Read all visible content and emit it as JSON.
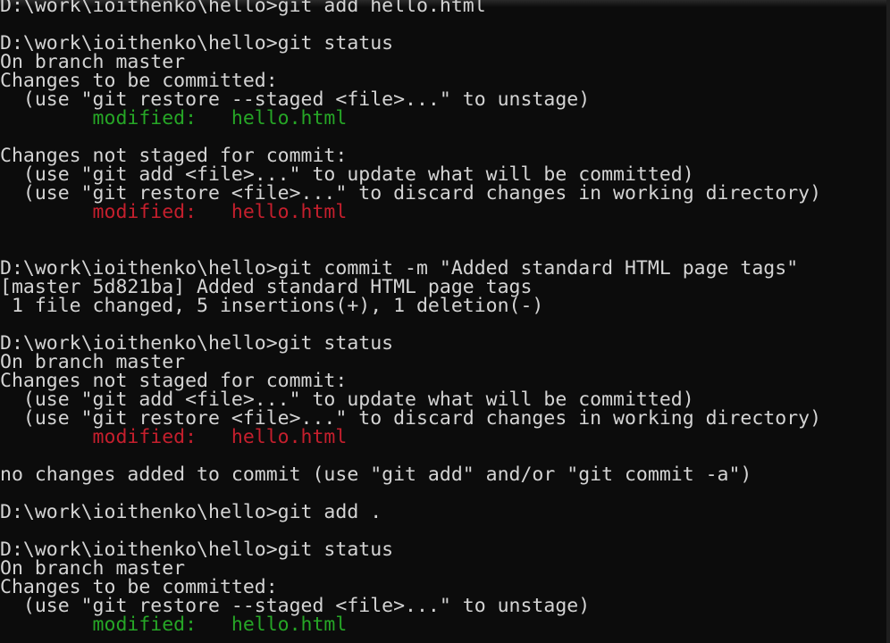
{
  "colors": {
    "background": "#0c0c0c",
    "text": "#d4d4d4",
    "staged": "#26a626",
    "unstaged": "#c51f2d"
  },
  "lines": [
    {
      "text": "D:\\work\\ioithenko\\hello>git add hello.html"
    },
    {
      "text": ""
    },
    {
      "text": "D:\\work\\ioithenko\\hello>git status"
    },
    {
      "text": "On branch master"
    },
    {
      "text": "Changes to be committed:"
    },
    {
      "text": "  (use \"git restore --staged <file>...\" to unstage)"
    },
    {
      "text": "        modified:   hello.html",
      "color": "green"
    },
    {
      "text": ""
    },
    {
      "text": "Changes not staged for commit:"
    },
    {
      "text": "  (use \"git add <file>...\" to update what will be committed)"
    },
    {
      "text": "  (use \"git restore <file>...\" to discard changes in working directory)"
    },
    {
      "text": "        modified:   hello.html",
      "color": "red"
    },
    {
      "text": ""
    },
    {
      "text": ""
    },
    {
      "text": "D:\\work\\ioithenko\\hello>git commit -m \"Added standard HTML page tags\""
    },
    {
      "text": "[master 5d821ba] Added standard HTML page tags"
    },
    {
      "text": " 1 file changed, 5 insertions(+), 1 deletion(-)"
    },
    {
      "text": ""
    },
    {
      "text": "D:\\work\\ioithenko\\hello>git status"
    },
    {
      "text": "On branch master"
    },
    {
      "text": "Changes not staged for commit:"
    },
    {
      "text": "  (use \"git add <file>...\" to update what will be committed)"
    },
    {
      "text": "  (use \"git restore <file>...\" to discard changes in working directory)"
    },
    {
      "text": "        modified:   hello.html",
      "color": "red"
    },
    {
      "text": ""
    },
    {
      "text": "no changes added to commit (use \"git add\" and/or \"git commit -a\")"
    },
    {
      "text": ""
    },
    {
      "text": "D:\\work\\ioithenko\\hello>git add ."
    },
    {
      "text": ""
    },
    {
      "text": "D:\\work\\ioithenko\\hello>git status"
    },
    {
      "text": "On branch master"
    },
    {
      "text": "Changes to be committed:"
    },
    {
      "text": "  (use \"git restore --staged <file>...\" to unstage)"
    },
    {
      "text": "        modified:   hello.html",
      "color": "green"
    },
    {
      "text": ""
    }
  ]
}
